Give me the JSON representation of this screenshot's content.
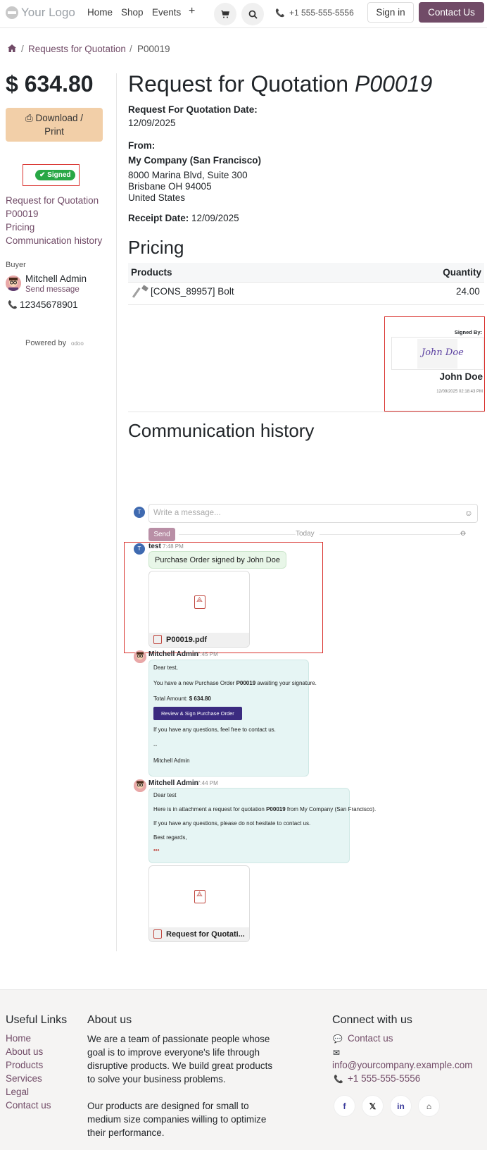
{
  "header": {
    "logo_text": "Your Logo",
    "nav": [
      "Home",
      "Shop",
      "Events",
      "+"
    ],
    "phone": "+1 555-555-5556",
    "signin_label": "Sign in",
    "contact_label": "Contact Us"
  },
  "breadcrumb": {
    "home_icon": "home-icon",
    "items": [
      "Requests for Quotation",
      "P00019"
    ],
    "separator": "/"
  },
  "sidebar": {
    "price": "$ 634.80",
    "download_label_line1": "Download /",
    "download_label_line2": "Print",
    "signed_badge": "✔ Signed",
    "links": [
      "Request for Quotation",
      "P00019",
      "Pricing",
      "Communication history"
    ],
    "buyer_label": "Buyer",
    "buyer_name": "Mitchell Admin",
    "send_message": "Send message",
    "buyer_phone": "12345678901",
    "powered_by": "Powered by",
    "powered_brand": "odoo"
  },
  "main": {
    "title_prefix": "Request for Quotation",
    "title_ref": "P00019",
    "rfq_date_label": "Request For Quotation Date:",
    "rfq_date": "12/09/2025",
    "from_label": "From:",
    "company": "My Company (San Francisco)",
    "address_line1": "8000 Marina Blvd, Suite 300",
    "address_line2": "Brisbane OH 94005",
    "address_line3": "United States",
    "receipt_label": "Receipt Date:",
    "receipt_date": "12/09/2025",
    "pricing_title": "Pricing",
    "table_headers": [
      "Products",
      "Quantity"
    ],
    "table_rows": [
      {
        "product": "[CONS_89957] Bolt",
        "quantity": "24.00"
      }
    ],
    "signed_by_label": "Signed By:",
    "signature_script": "John Doe",
    "signer_name": "John Doe",
    "signed_date": "12/09/2025 02:18:43 PM",
    "comm_title": "Communication history"
  },
  "chatter": {
    "input_placeholder": "Write a message...",
    "send_label": "Send",
    "today_label": "Today",
    "messages": [
      {
        "author": "test",
        "time": "7:48 PM",
        "avatar_letter": "T",
        "body": "Purchase Order signed by John Doe",
        "attachment": "P00019.pdf"
      },
      {
        "author": "Mitchell Admin",
        "time": "7:45 PM",
        "greeting": "Dear test,",
        "line1_pre": "You have a new Purchase Order ",
        "line1_ref": "P00019",
        "line1_post": " awaiting your signature.",
        "total_label": "Total Amount: ",
        "total_value": "$ 634.80",
        "button": "Review & Sign Purchase Order",
        "line2": "If you have any questions, feel free to contact us.",
        "dashes": "--",
        "signature": "Mitchell Admin"
      },
      {
        "author": "Mitchell Admin",
        "time": "7:44 PM",
        "greeting": "Dear test",
        "line1_pre": "Here is in attachment a request for quotation ",
        "line1_ref": "P00019",
        "line1_post": " from My Company (San Francisco).",
        "line2": "If you have any questions, please do not hesitate to contact us.",
        "regards": "Best regards,",
        "more": "•••",
        "attachment": "Request for Quotati..."
      }
    ]
  },
  "footer": {
    "useful_links_title": "Useful Links",
    "useful_links": [
      "Home",
      "About us",
      "Products",
      "Services",
      "Legal",
      "Contact us"
    ],
    "about_title": "About us",
    "about_p1_l1": "We are a team of passionate people whose",
    "about_p1_l2": "goal is to improve everyone's life through",
    "about_p1_l3": "disruptive products. We build great products",
    "about_p1_l4": "to solve your business problems.",
    "about_p2_l1": "Our products are designed for small to",
    "about_p2_l2": "medium size companies willing to optimize",
    "about_p2_l3": "their performance.",
    "connect_title": "Connect with us",
    "contact_link": "Contact us",
    "email": "info@yourcompany.example.com",
    "phone": "+1 555-555-5556",
    "social": [
      "f",
      "𝕏",
      "in",
      "⌂"
    ]
  },
  "colors": {
    "brand": "#714b67",
    "signed_green": "#28a745",
    "download_bg": "#f2cfa8",
    "highlight_red": "#d9322e"
  }
}
